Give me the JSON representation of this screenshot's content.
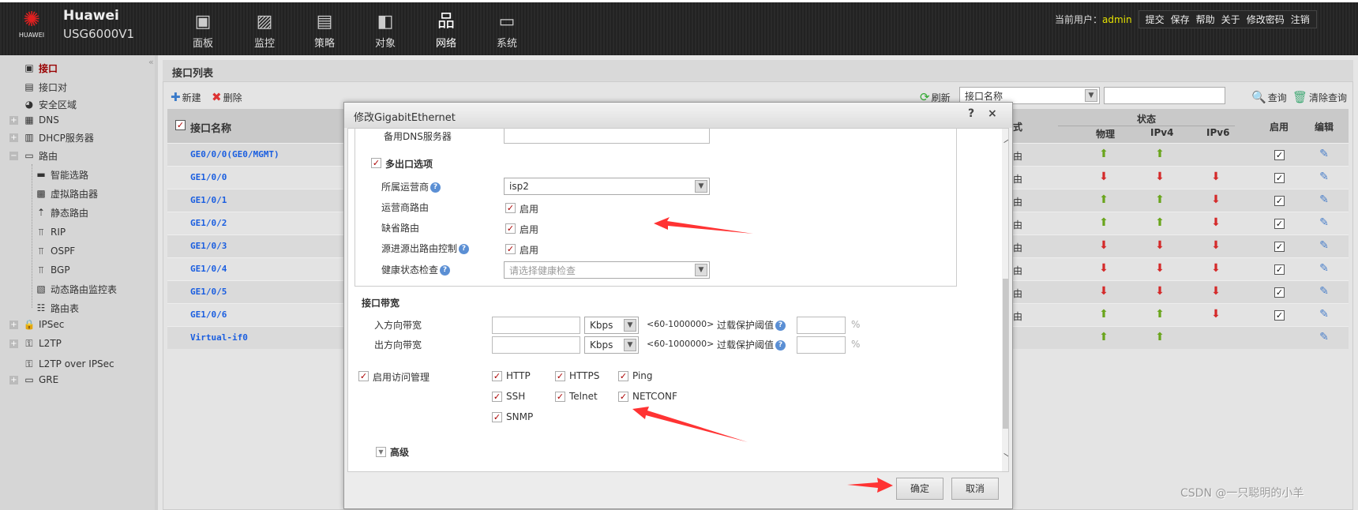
{
  "header": {
    "brand": "Huawei",
    "model": "USG6000V1",
    "logo_text": "HUAWEI",
    "nav": [
      {
        "label": "面板",
        "icon": "dashboard-icon",
        "glyph": "▣"
      },
      {
        "label": "监控",
        "icon": "monitor-icon",
        "glyph": "▨"
      },
      {
        "label": "策略",
        "icon": "policy-icon",
        "glyph": "▤"
      },
      {
        "label": "对象",
        "icon": "object-icon",
        "glyph": "◧"
      },
      {
        "label": "网络",
        "icon": "network-icon",
        "glyph": "品",
        "active": true
      },
      {
        "label": "系统",
        "icon": "system-icon",
        "glyph": "▭"
      }
    ],
    "user_label": "当前用户：",
    "user": "admin",
    "links": [
      "提交",
      "保存",
      "帮助",
      "关于",
      "修改密码",
      "注销"
    ]
  },
  "sidebar": {
    "collapse": "«",
    "items": [
      {
        "label": "接口",
        "icon": "interface-icon",
        "glyph": "▣",
        "level": 0,
        "selected": true
      },
      {
        "label": "接口对",
        "icon": "interface-pair-icon",
        "glyph": "▤",
        "level": 0
      },
      {
        "label": "安全区域",
        "icon": "security-zone-icon",
        "glyph": "◕",
        "level": 0
      },
      {
        "label": "DNS",
        "icon": "dns-icon",
        "glyph": "▦",
        "level": 0,
        "expander": "+"
      },
      {
        "label": "DHCP服务器",
        "icon": "dhcp-server-icon",
        "glyph": "▥",
        "level": 0,
        "expander": "+"
      },
      {
        "label": "路由",
        "icon": "route-icon",
        "glyph": "▭",
        "level": 0,
        "expander": "−"
      },
      {
        "label": "智能选路",
        "icon": "smart-route-icon",
        "glyph": "▬",
        "level": 1
      },
      {
        "label": "虚拟路由器",
        "icon": "virtual-router-icon",
        "glyph": "▩",
        "level": 1
      },
      {
        "label": "静态路由",
        "icon": "static-route-icon",
        "glyph": "⇡",
        "level": 1
      },
      {
        "label": "RIP",
        "icon": "rip-icon",
        "glyph": "⫪",
        "level": 1
      },
      {
        "label": "OSPF",
        "icon": "ospf-icon",
        "glyph": "⫪",
        "level": 1
      },
      {
        "label": "BGP",
        "icon": "bgp-icon",
        "glyph": "⫪",
        "level": 1
      },
      {
        "label": "动态路由监控表",
        "icon": "route-monitor-icon",
        "glyph": "▧",
        "level": 1
      },
      {
        "label": "路由表",
        "icon": "route-table-icon",
        "glyph": "☷",
        "level": 1
      },
      {
        "label": "IPSec",
        "icon": "ipsec-icon",
        "glyph": "🔒",
        "level": 0,
        "expander": "+"
      },
      {
        "label": "L2TP",
        "icon": "l2tp-icon",
        "glyph": "⚿",
        "level": 0,
        "expander": "+"
      },
      {
        "label": "L2TP over IPSec",
        "icon": "l2tp-over-ipsec-icon",
        "glyph": "⚿",
        "level": 0
      },
      {
        "label": "GRE",
        "icon": "gre-icon",
        "glyph": "▭",
        "level": 0,
        "expander": "+"
      }
    ]
  },
  "panel": {
    "title": "接口列表",
    "new": "新建",
    "delete": "删除",
    "refresh": "刷新",
    "search_field": "接口名称",
    "search_value": "",
    "query": "查询",
    "clear_query": "清除查询"
  },
  "table": {
    "columns": {
      "name": "接口名称",
      "mode": "式",
      "status": "状态",
      "phys": "物理",
      "ipv4": "IPv4",
      "ipv6": "IPv6",
      "enabled": "启用",
      "edit": "编辑"
    },
    "rows": [
      {
        "name": "GE0/0/0(GE0/MGMT)",
        "mode": "由",
        "phys": "up",
        "ipv4": "up",
        "ipv6": "",
        "enabled": true
      },
      {
        "name": "GE1/0/0",
        "mode": "由",
        "phys": "down",
        "ipv4": "down",
        "ipv6": "down",
        "enabled": true
      },
      {
        "name": "GE1/0/1",
        "mode": "由",
        "phys": "up",
        "ipv4": "up",
        "ipv6": "down",
        "enabled": true
      },
      {
        "name": "GE1/0/2",
        "mode": "由",
        "phys": "up",
        "ipv4": "up",
        "ipv6": "down",
        "enabled": true
      },
      {
        "name": "GE1/0/3",
        "mode": "由",
        "phys": "down",
        "ipv4": "down",
        "ipv6": "down",
        "enabled": true
      },
      {
        "name": "GE1/0/4",
        "mode": "由",
        "phys": "down",
        "ipv4": "down",
        "ipv6": "down",
        "enabled": true
      },
      {
        "name": "GE1/0/5",
        "mode": "由",
        "phys": "down",
        "ipv4": "down",
        "ipv6": "down",
        "enabled": true
      },
      {
        "name": "GE1/0/6",
        "mode": "由",
        "phys": "up",
        "ipv4": "up",
        "ipv6": "down",
        "enabled": true
      },
      {
        "name": "Virtual-if0",
        "mode": "",
        "phys": "up",
        "ipv4": "up",
        "ipv6": "",
        "enabled": false
      }
    ]
  },
  "dialog": {
    "title": "修改GigabitEthernet",
    "help": "?",
    "close": "×",
    "backup_dns_label": "备用DNS服务器",
    "backup_dns_value": "",
    "multi_exit": {
      "label": "多出口选项",
      "checked": true,
      "isp_label": "所属运营商",
      "isp_value": "isp2",
      "isp_route_label": "运营商路由",
      "isp_route": "启用",
      "default_route_label": "缺省路由",
      "default_route": "启用",
      "src_route_label": "源进源出路由控制",
      "src_route": "启用",
      "health_label": "健康状态检查",
      "health_placeholder": "请选择健康检查"
    },
    "bandwidth": {
      "title": "接口带宽",
      "in_label": "入方向带宽",
      "out_label": "出方向带宽",
      "unit": "Kbps",
      "range": "<60-1000000>",
      "overload_label": "过载保护阈值",
      "percent": "%",
      "in_value": "",
      "out_value": "",
      "in_threshold": "",
      "out_threshold": ""
    },
    "access": {
      "label": "启用访问管理",
      "checked": true,
      "services": [
        "HTTP",
        "HTTPS",
        "Ping",
        "SSH",
        "Telnet",
        "NETCONF",
        "SNMP"
      ]
    },
    "advanced": "高级",
    "ok": "确定",
    "cancel": "取消"
  },
  "annotation_color": "#ff3333",
  "watermark": "CSDN @一只聪明的小羊"
}
